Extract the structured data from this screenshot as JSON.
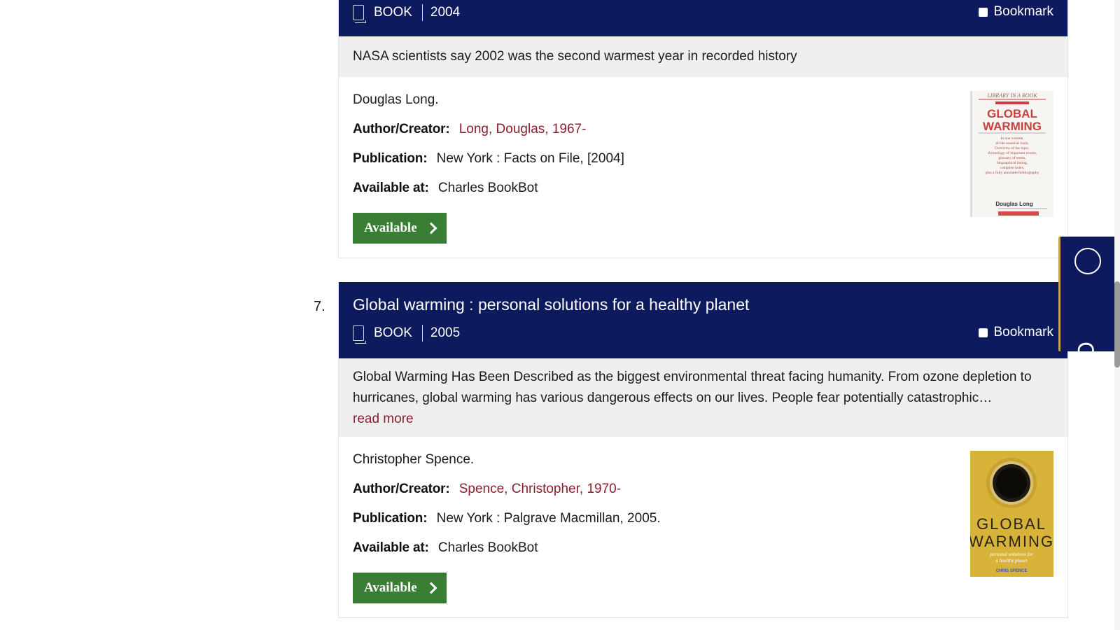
{
  "result6": {
    "format": "BOOK",
    "year": "2004",
    "bookmark_label": "Bookmark",
    "description": "NASA scientists say 2002 was the second warmest year in recorded history",
    "statement": "Douglas Long.",
    "author_label": "Author/Creator:",
    "author": "Long, Douglas, 1967-",
    "publication_label": "Publication:",
    "publication": "New York : Facts on File, [2004]",
    "available_label": "Available at:",
    "location": "Charles BookBot",
    "status_button": "Available",
    "cover": {
      "series": "LIBRARY IN A BOOK",
      "title_line1": "GLOBAL",
      "title_line2": "WARMING",
      "blurb": [
        "In one volume,",
        "all the essential tools:",
        "Overview of the topic,",
        "chronology of important events,",
        "glossary of terms,",
        "biographical listing,",
        "complete index,",
        "plus a fully annotated bibliography"
      ],
      "author": "Douglas Long"
    }
  },
  "result7": {
    "number": "7.",
    "title": "Global warming : personal solutions for a healthy planet",
    "format": "BOOK",
    "year": "2005",
    "bookmark_label": "Bookmark",
    "description": "Global Warming Has Been Described as the biggest environmental threat facing humanity. From ozone depletion to hurricanes, global warming has various dangerous effects on our lives. People fear potentially catastrophic…",
    "read_more": "read more",
    "statement": "Christopher Spence.",
    "author_label": "Author/Creator:",
    "author": "Spence, Christopher, 1970-",
    "publication_label": "Publication:",
    "publication": "New York : Palgrave Macmillan, 2005.",
    "available_label": "Available at:",
    "location": "Charles BookBot",
    "status_button": "Available",
    "cover": {
      "title_line1": "GLOBAL",
      "title_line2": "WARMING",
      "subtitle_line1": "personal solutions for",
      "subtitle_line2": "a healthy planet",
      "author": "CHRIS SPENCE"
    }
  },
  "chat": {
    "label": "Chat"
  },
  "colors": {
    "header_navy": "#0e1a5e",
    "link_red": "#8b1e2e",
    "available_green": "#3a7d34",
    "description_gray": "#efefef"
  }
}
